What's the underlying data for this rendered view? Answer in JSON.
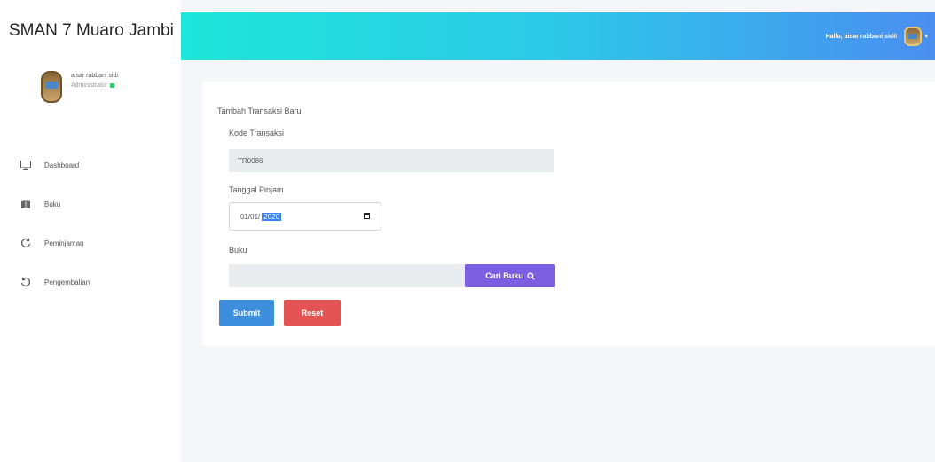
{
  "brand": "SMAN 7 Muaro Jambi",
  "user": {
    "name": "aisar rabbani sidi",
    "role": "Administrator",
    "greeting": "Hallo, aisar rabbani sidi!"
  },
  "nav": [
    {
      "label": "Dashboard",
      "icon": "monitor-icon"
    },
    {
      "label": "Buku",
      "icon": "book-icon"
    },
    {
      "label": "Peminjaman",
      "icon": "refresh-icon"
    },
    {
      "label": "Pengembalian",
      "icon": "undo-icon"
    }
  ],
  "form": {
    "title": "Tambah Transaksi Baru",
    "kode_label": "Kode Transaksi",
    "kode_value": "TR0086",
    "tanggal_label": "Tanggal Pinjam",
    "tanggal_prefix": "01/01/",
    "tanggal_year": "2020",
    "buku_label": "Buku",
    "buku_value": "",
    "cari_label": "Cari Buku",
    "submit_label": "Submit",
    "reset_label": "Reset"
  },
  "colors": {
    "header_start": "#1ee6d9",
    "header_end": "#4a8ef0",
    "submit": "#3d8fdd",
    "reset": "#e55454",
    "cari": "#7b5fe0"
  }
}
